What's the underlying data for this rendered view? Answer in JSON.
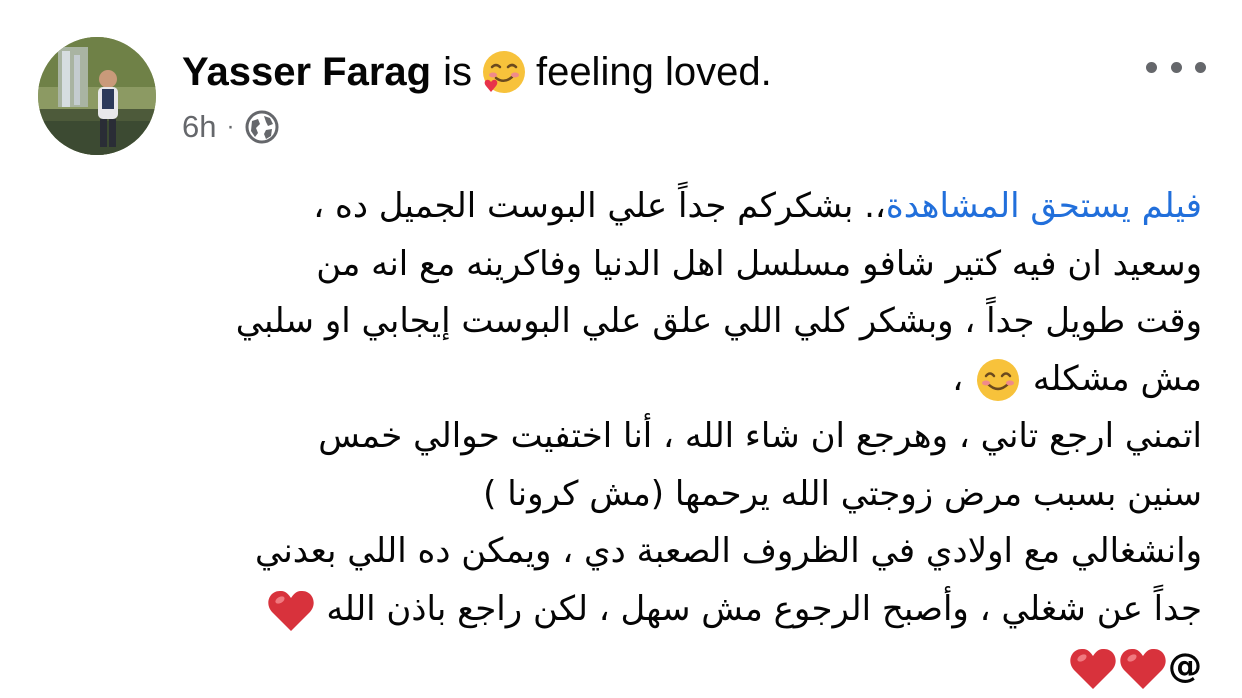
{
  "post": {
    "author": "Yasser Farag",
    "verb": "is",
    "feeling": "feeling loved.",
    "time": "6h",
    "separator": "·",
    "audience_icon": "globe-icon",
    "more_icon": "more-horizontal-icon",
    "body": {
      "line1_link": "فيلم يستحق المشاهدة",
      "line1_rest": "،. بشكركم جداً علي البوست الجميل ده ،",
      "line2": "وسعيد ان فيه كتير شافو مسلسل اهل الدنيا وفاكرينه مع انه من",
      "line3": "وقت طويل جداً ، وبشكر كلي اللي علق علي البوست إيجابي او سلبي",
      "line4": "مش مشكله",
      "line4_after": "،",
      "line5": "اتمني ارجع تاني ، وهرجع  ان شاء الله ، أنا اختفيت حوالي خمس",
      "line6": "سنين بسبب مرض زوجتي الله يرحمها (مش كرونا )",
      "line7": "وانشغالي مع اولادي في الظروف الصعبة دي ، ويمكن ده اللي بعدني",
      "line8": "جداً عن  شغلي ، وأصبح الرجوع مش سهل ، لكن راجع باذن الله",
      "line9": "@"
    },
    "colors": {
      "link": "#216fdb",
      "meta": "#65676b",
      "heart": "#d8323c"
    }
  }
}
